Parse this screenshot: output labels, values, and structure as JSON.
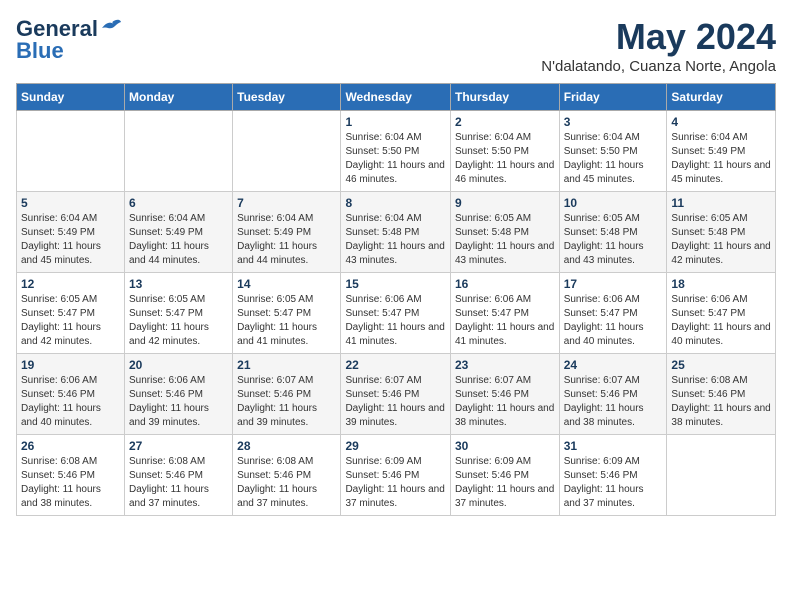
{
  "logo": {
    "line1": "General",
    "line2": "Blue"
  },
  "title": "May 2024",
  "subtitle": "N'dalatando, Cuanza Norte, Angola",
  "weekdays": [
    "Sunday",
    "Monday",
    "Tuesday",
    "Wednesday",
    "Thursday",
    "Friday",
    "Saturday"
  ],
  "weeks": [
    [
      {
        "day": "",
        "sunrise": "",
        "sunset": "",
        "daylight": ""
      },
      {
        "day": "",
        "sunrise": "",
        "sunset": "",
        "daylight": ""
      },
      {
        "day": "",
        "sunrise": "",
        "sunset": "",
        "daylight": ""
      },
      {
        "day": "1",
        "sunrise": "Sunrise: 6:04 AM",
        "sunset": "Sunset: 5:50 PM",
        "daylight": "Daylight: 11 hours and 46 minutes."
      },
      {
        "day": "2",
        "sunrise": "Sunrise: 6:04 AM",
        "sunset": "Sunset: 5:50 PM",
        "daylight": "Daylight: 11 hours and 46 minutes."
      },
      {
        "day": "3",
        "sunrise": "Sunrise: 6:04 AM",
        "sunset": "Sunset: 5:50 PM",
        "daylight": "Daylight: 11 hours and 45 minutes."
      },
      {
        "day": "4",
        "sunrise": "Sunrise: 6:04 AM",
        "sunset": "Sunset: 5:49 PM",
        "daylight": "Daylight: 11 hours and 45 minutes."
      }
    ],
    [
      {
        "day": "5",
        "sunrise": "Sunrise: 6:04 AM",
        "sunset": "Sunset: 5:49 PM",
        "daylight": "Daylight: 11 hours and 45 minutes."
      },
      {
        "day": "6",
        "sunrise": "Sunrise: 6:04 AM",
        "sunset": "Sunset: 5:49 PM",
        "daylight": "Daylight: 11 hours and 44 minutes."
      },
      {
        "day": "7",
        "sunrise": "Sunrise: 6:04 AM",
        "sunset": "Sunset: 5:49 PM",
        "daylight": "Daylight: 11 hours and 44 minutes."
      },
      {
        "day": "8",
        "sunrise": "Sunrise: 6:04 AM",
        "sunset": "Sunset: 5:48 PM",
        "daylight": "Daylight: 11 hours and 43 minutes."
      },
      {
        "day": "9",
        "sunrise": "Sunrise: 6:05 AM",
        "sunset": "Sunset: 5:48 PM",
        "daylight": "Daylight: 11 hours and 43 minutes."
      },
      {
        "day": "10",
        "sunrise": "Sunrise: 6:05 AM",
        "sunset": "Sunset: 5:48 PM",
        "daylight": "Daylight: 11 hours and 43 minutes."
      },
      {
        "day": "11",
        "sunrise": "Sunrise: 6:05 AM",
        "sunset": "Sunset: 5:48 PM",
        "daylight": "Daylight: 11 hours and 42 minutes."
      }
    ],
    [
      {
        "day": "12",
        "sunrise": "Sunrise: 6:05 AM",
        "sunset": "Sunset: 5:47 PM",
        "daylight": "Daylight: 11 hours and 42 minutes."
      },
      {
        "day": "13",
        "sunrise": "Sunrise: 6:05 AM",
        "sunset": "Sunset: 5:47 PM",
        "daylight": "Daylight: 11 hours and 42 minutes."
      },
      {
        "day": "14",
        "sunrise": "Sunrise: 6:05 AM",
        "sunset": "Sunset: 5:47 PM",
        "daylight": "Daylight: 11 hours and 41 minutes."
      },
      {
        "day": "15",
        "sunrise": "Sunrise: 6:06 AM",
        "sunset": "Sunset: 5:47 PM",
        "daylight": "Daylight: 11 hours and 41 minutes."
      },
      {
        "day": "16",
        "sunrise": "Sunrise: 6:06 AM",
        "sunset": "Sunset: 5:47 PM",
        "daylight": "Daylight: 11 hours and 41 minutes."
      },
      {
        "day": "17",
        "sunrise": "Sunrise: 6:06 AM",
        "sunset": "Sunset: 5:47 PM",
        "daylight": "Daylight: 11 hours and 40 minutes."
      },
      {
        "day": "18",
        "sunrise": "Sunrise: 6:06 AM",
        "sunset": "Sunset: 5:47 PM",
        "daylight": "Daylight: 11 hours and 40 minutes."
      }
    ],
    [
      {
        "day": "19",
        "sunrise": "Sunrise: 6:06 AM",
        "sunset": "Sunset: 5:46 PM",
        "daylight": "Daylight: 11 hours and 40 minutes."
      },
      {
        "day": "20",
        "sunrise": "Sunrise: 6:06 AM",
        "sunset": "Sunset: 5:46 PM",
        "daylight": "Daylight: 11 hours and 39 minutes."
      },
      {
        "day": "21",
        "sunrise": "Sunrise: 6:07 AM",
        "sunset": "Sunset: 5:46 PM",
        "daylight": "Daylight: 11 hours and 39 minutes."
      },
      {
        "day": "22",
        "sunrise": "Sunrise: 6:07 AM",
        "sunset": "Sunset: 5:46 PM",
        "daylight": "Daylight: 11 hours and 39 minutes."
      },
      {
        "day": "23",
        "sunrise": "Sunrise: 6:07 AM",
        "sunset": "Sunset: 5:46 PM",
        "daylight": "Daylight: 11 hours and 38 minutes."
      },
      {
        "day": "24",
        "sunrise": "Sunrise: 6:07 AM",
        "sunset": "Sunset: 5:46 PM",
        "daylight": "Daylight: 11 hours and 38 minutes."
      },
      {
        "day": "25",
        "sunrise": "Sunrise: 6:08 AM",
        "sunset": "Sunset: 5:46 PM",
        "daylight": "Daylight: 11 hours and 38 minutes."
      }
    ],
    [
      {
        "day": "26",
        "sunrise": "Sunrise: 6:08 AM",
        "sunset": "Sunset: 5:46 PM",
        "daylight": "Daylight: 11 hours and 38 minutes."
      },
      {
        "day": "27",
        "sunrise": "Sunrise: 6:08 AM",
        "sunset": "Sunset: 5:46 PM",
        "daylight": "Daylight: 11 hours and 37 minutes."
      },
      {
        "day": "28",
        "sunrise": "Sunrise: 6:08 AM",
        "sunset": "Sunset: 5:46 PM",
        "daylight": "Daylight: 11 hours and 37 minutes."
      },
      {
        "day": "29",
        "sunrise": "Sunrise: 6:09 AM",
        "sunset": "Sunset: 5:46 PM",
        "daylight": "Daylight: 11 hours and 37 minutes."
      },
      {
        "day": "30",
        "sunrise": "Sunrise: 6:09 AM",
        "sunset": "Sunset: 5:46 PM",
        "daylight": "Daylight: 11 hours and 37 minutes."
      },
      {
        "day": "31",
        "sunrise": "Sunrise: 6:09 AM",
        "sunset": "Sunset: 5:46 PM",
        "daylight": "Daylight: 11 hours and 37 minutes."
      },
      {
        "day": "",
        "sunrise": "",
        "sunset": "",
        "daylight": ""
      }
    ]
  ]
}
